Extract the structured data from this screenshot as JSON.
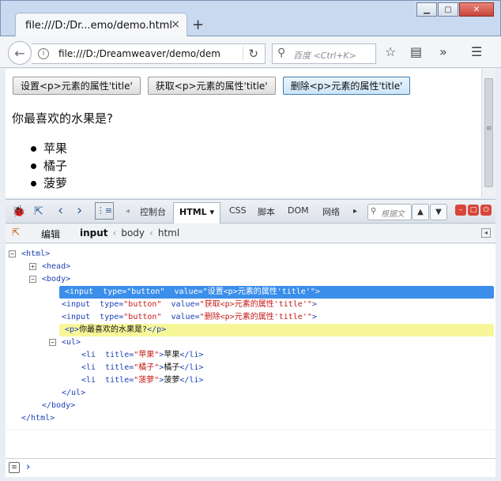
{
  "window": {
    "tab_title": "file:///D:/Dr...emo/demo.html",
    "tab_close": "×",
    "new_tab": "+",
    "minimize": "▁",
    "maximize": "▢",
    "close": "✕"
  },
  "navbar": {
    "back": "←",
    "info": "i",
    "url": "file:///D:/Dreamweaver/demo/dem",
    "reload": "↻",
    "search_placeholder": "百度 <Ctrl+K>",
    "search_icon": "⚲",
    "bookmark_icon": "☆",
    "reader_icon": "▤",
    "more_icon": "»",
    "menu_icon": "☰"
  },
  "page": {
    "buttons": [
      "设置<p>元素的属性'title'",
      "获取<p>元素的属性'title'",
      "删除<p>元素的属性'title'"
    ],
    "question": "你最喜欢的水果是?",
    "fruits": [
      "苹果",
      "橘子",
      "菠萝"
    ]
  },
  "devtools": {
    "icons": {
      "firebug": "🐞",
      "inspect": "⇱",
      "back": "‹",
      "forward": "›",
      "console_toggle": "⋮≡",
      "left_arrow": "◂",
      "right_arrow": "▸"
    },
    "tabs": [
      "控制台",
      "HTML ▾",
      "CSS",
      "脚本",
      "DOM",
      "网络"
    ],
    "search_placeholder": "根据文",
    "prev": "▲",
    "next": "▼",
    "breadcrumb_edit": "编辑",
    "breadcrumbs": [
      "input",
      "body",
      "html"
    ],
    "crumb_sep": "‹",
    "minimize": "–",
    "detach": "□",
    "close": "⏻",
    "cmd_icon": "≡",
    "cmd_prompt": "›",
    "tree": [
      {
        "indent": 0,
        "toggle": "−",
        "tag_open": "<html>",
        "rest": ""
      },
      {
        "indent": 1,
        "toggle": "+",
        "tag_open": "<head>",
        "rest": ""
      },
      {
        "indent": 1,
        "toggle": "−",
        "tag_open": "<body>",
        "rest": ""
      },
      {
        "indent": 2,
        "toggle": "",
        "tag_open": "<input ",
        "attr": "type=",
        "val": "\"button\"",
        "attr2": "  value=",
        "val2": "\"设置<p>元素的属性'title'\"",
        "tag_close": ">",
        "state": "selected"
      },
      {
        "indent": 2,
        "toggle": "",
        "tag_open": "<input ",
        "attr": "type=",
        "val": "\"button\"",
        "attr2": "  value=",
        "val2": "\"获取<p>元素的属性'title'\"",
        "tag_close": ">",
        "state": ""
      },
      {
        "indent": 2,
        "toggle": "",
        "tag_open": "<input ",
        "attr": "type=",
        "val": "\"button\"",
        "attr2": "  value=",
        "val2": "\"删除<p>元素的属性'title'\"",
        "tag_close": ">",
        "state": ""
      },
      {
        "indent": 2,
        "toggle": "",
        "tag_open": "<p>",
        "text": "你最喜欢的水果是?",
        "tag_end": "</p>",
        "state": "highlighted"
      },
      {
        "indent": 2,
        "toggle": "−",
        "tag_open": "<ul>",
        "rest": ""
      },
      {
        "indent": 3,
        "toggle": "",
        "tag_open": "<li ",
        "attr": "title=",
        "val": "\"苹果\"",
        "tag_close": ">",
        "text": "苹果",
        "tag_end": "</li>"
      },
      {
        "indent": 3,
        "toggle": "",
        "tag_open": "<li ",
        "attr": "title=",
        "val": "\"橘子\"",
        "tag_close": ">",
        "text": "橘子",
        "tag_end": "</li>"
      },
      {
        "indent": 3,
        "toggle": "",
        "tag_open": "<li ",
        "attr": "title=",
        "val": "\"菠萝\"",
        "tag_close": ">",
        "text": "菠萝",
        "tag_end": "</li>"
      },
      {
        "indent": 2,
        "toggle": "",
        "tag_open": "</ul>",
        "rest": ""
      },
      {
        "indent": 1,
        "toggle": "",
        "tag_open": "</body>",
        "rest": ""
      },
      {
        "indent": 0,
        "toggle": "",
        "tag_open": "</html>",
        "rest": ""
      }
    ]
  }
}
